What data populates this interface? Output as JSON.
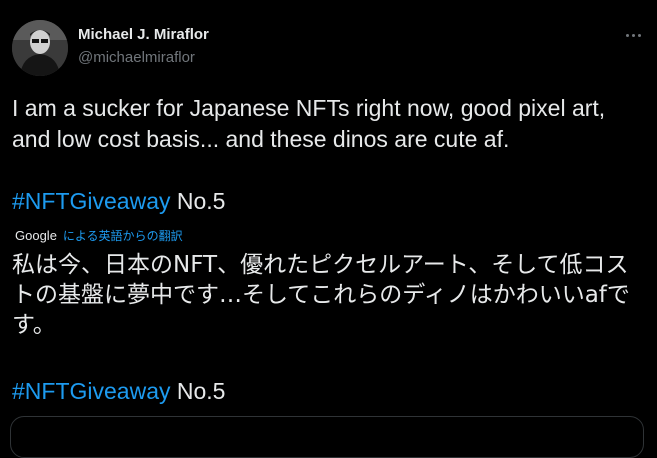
{
  "author": {
    "name": "Michael J. Miraflor",
    "handle": "@michaelmiraflor",
    "avatar_icon": "profile-photo"
  },
  "tweet": {
    "text": "I am a sucker for Japanese NFTs right now, good pixel art, and low cost basis... and these dinos are cute af.",
    "hashtag": "#NFTGiveaway",
    "hashtag_suffix": " No.5"
  },
  "translation": {
    "provider": "Google",
    "label": "による英語からの翻訳",
    "text": "私は今、日本のNFT、優れたピクセルアート、そして低コストの基盤に夢中です…そしてこれらのディノはかわいいafです。",
    "hashtag": "#NFTGiveaway",
    "hashtag_suffix": " No.5"
  },
  "colors": {
    "background": "#000000",
    "text": "#e7e9ea",
    "secondary": "#71767b",
    "link": "#1d9bf0"
  },
  "icons": {
    "more": "more-options-icon"
  }
}
